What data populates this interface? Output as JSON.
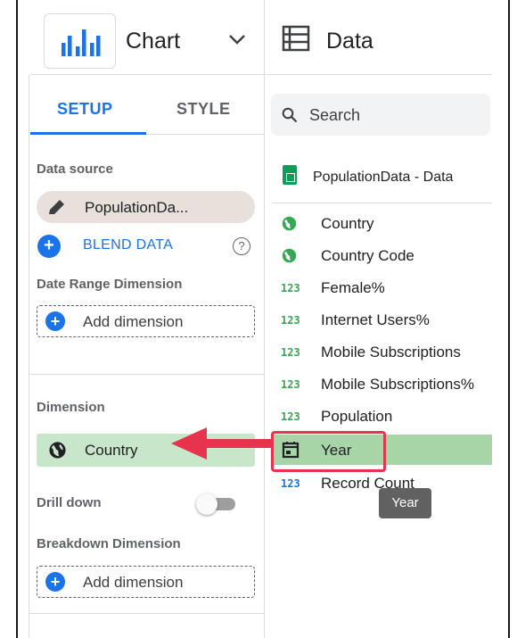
{
  "header": {
    "chart_label": "Chart",
    "data_label": "Data"
  },
  "tabs": [
    {
      "label": "SETUP",
      "active": true
    },
    {
      "label": "STYLE",
      "active": false
    }
  ],
  "setup": {
    "data_source_label": "Data source",
    "data_source_name": "PopulationDa...",
    "blend_label": "BLEND DATA",
    "help_symbol": "?",
    "date_range_label": "Date Range Dimension",
    "add_dimension_label": "Add dimension",
    "dimension_label": "Dimension",
    "dimension_value": "Country",
    "drill_down_label": "Drill down",
    "drill_down_on": false,
    "breakdown_label": "Breakdown Dimension",
    "breakdown_add_label": "Add dimension",
    "plus_symbol": "+"
  },
  "data_panel": {
    "search_placeholder": "Search",
    "source_name": "PopulationData - Data",
    "fields": [
      {
        "name": "Country",
        "type": "geo-icon"
      },
      {
        "name": "Country Code",
        "type": "geo-icon"
      },
      {
        "name": "Female%",
        "type": "number",
        "symbol": "123"
      },
      {
        "name": "Internet Users%",
        "type": "number",
        "symbol": "123"
      },
      {
        "name": "Mobile Subscriptions",
        "type": "number",
        "symbol": "123"
      },
      {
        "name": "Mobile Subscriptions%",
        "type": "number",
        "symbol": "123"
      },
      {
        "name": "Population",
        "type": "number",
        "symbol": "123"
      },
      {
        "name": "Year",
        "type": "calendar-icon",
        "selected": true
      },
      {
        "name": "Record Count",
        "type": "number",
        "symbol": "123"
      }
    ],
    "tooltip": "Year"
  },
  "colors": {
    "accent": "#1a73e8",
    "selected_field": "#a8d5a8",
    "dimension_chip": "#c8e6c9",
    "highlight": "#e8334f",
    "number_green": "#34a853"
  }
}
